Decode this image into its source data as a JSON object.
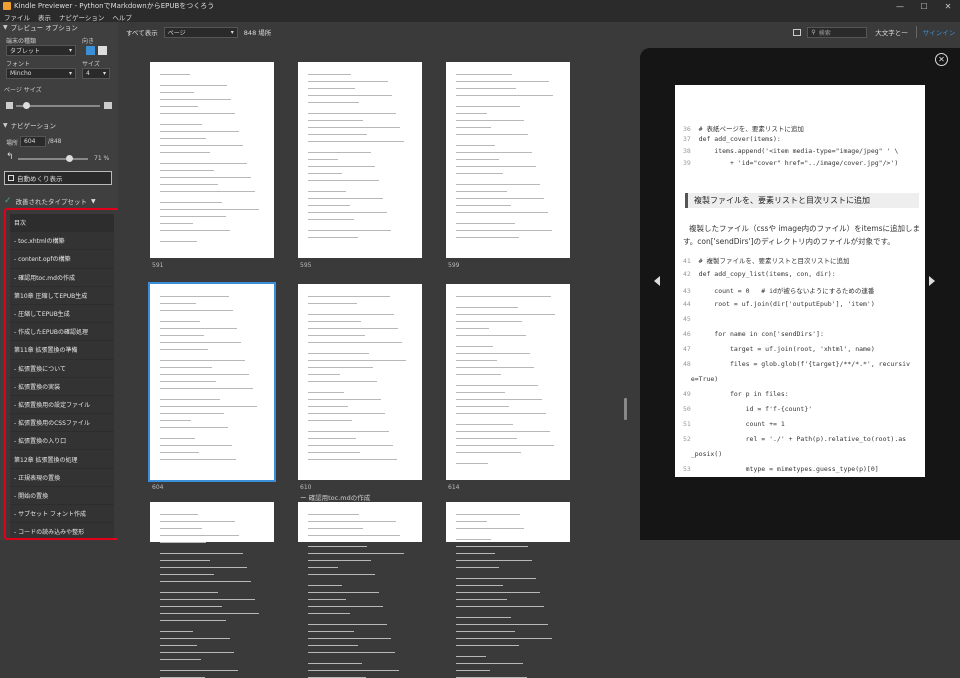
{
  "window": {
    "title": "Kindle Previewer - PythonでMarkdownからEPUBをつくろう",
    "min": "—",
    "max": "☐",
    "close": "✕"
  },
  "menu": [
    "ファイル",
    "表示",
    "ナビゲーション",
    "ヘルプ"
  ],
  "sidebar": {
    "preview_options": "プレビュー オプション",
    "device_type_label": "端末の種類",
    "orientation_label": "向き",
    "device_value": "タブレット",
    "font_label": "フォント",
    "size_label": "サイズ",
    "font_value": "Mincho",
    "size_value": "4",
    "page_size_label": "ページ サイズ",
    "navigation": "ナビゲーション",
    "location_label": "場所",
    "location_value": "604",
    "location_total": "/848",
    "percent": "71 %",
    "auto_advance": "自動めくり表示",
    "tagged_label": "改善されたタイプセット",
    "toc_items": [
      "目次",
      "- toc.xhtmlの構築",
      "- content.opfの構築",
      "- 確認用toc.mdの作成",
      "第10章 圧縮してEPUB生成",
      "- 圧縮してEPUB生成",
      "- 作成したEPUBの確認処理",
      "第11章 拡張置換の準備",
      "- 拡張置換について",
      "- 拡張置換の実装",
      "- 拡張置換用の設定ファイル",
      "- 拡張置換用のCSSファイル",
      "- 拡張置換の入り口",
      "第12章 拡張置換の処理",
      "- 正規表現の置換",
      "- 開始の置換",
      "- サブセット フォント作成",
      "- コードの読み込みや整形"
    ]
  },
  "topbar": {
    "view_label": "すべて表示",
    "view_value": "ページ",
    "count": "848 場所",
    "search_placeholder": "検索",
    "font_big": "大文字と一",
    "signin": "サインイン"
  },
  "pages": [
    {
      "num": "591"
    },
    {
      "num": "595"
    },
    {
      "num": "599"
    },
    {
      "num": "604"
    },
    {
      "num": "610"
    },
    {
      "num": "614"
    }
  ],
  "section_caption": "ー 確認用toc.mdの作成",
  "kindle": {
    "code1": [
      {
        "ln": "36",
        "text": "# 表紙ページを、要素リストに追加"
      },
      {
        "ln": "37",
        "text": "def add_cover(items):"
      },
      {
        "ln": "38",
        "text": "    items.append('<item media-type=\"image/jpeg\" ' \\"
      },
      {
        "ln": "39",
        "text": "        + 'id=\"cover\" href=\"../image/cover.jpg\"/>')"
      }
    ],
    "heading": "複製ファイルを、要素リストと目次リストに追加",
    "para": [
      "複製したファイル（cssや image内のファイル）をitemsに追加しま",
      "す。con['sendDirs']のディレクトリ内のファイルが対象です。"
    ],
    "code2": [
      {
        "ln": "41",
        "text": "# 複製ファイルを、要素リストと目次リストに追加"
      },
      {
        "ln": "42",
        "text": "def add_copy_list(items, con, dir):"
      },
      {
        "ln": "43",
        "text": "    count = 0   # idが被らないようにするための連番"
      },
      {
        "ln": "44",
        "text": "    root = uf.join(dir['outputEpub'], 'item')"
      },
      {
        "ln": "45",
        "text": ""
      },
      {
        "ln": "46",
        "text": "    for name in con['sendDirs']:"
      },
      {
        "ln": "47",
        "text": "        target = uf.join(root, 'xhtml', name)"
      },
      {
        "ln": "48",
        "text": "        files = glob.glob(f'{target}/**/*.*', recursiv"
      },
      {
        "ln": "",
        "text": "e=True)"
      },
      {
        "ln": "49",
        "text": "        for p in files:"
      },
      {
        "ln": "50",
        "text": "            id = f'f-{count}'"
      },
      {
        "ln": "51",
        "text": "            count += 1"
      },
      {
        "ln": "52",
        "text": "            rel = './' + Path(p).relative_to(root).as"
      },
      {
        "ln": "",
        "text": "_posix()"
      },
      {
        "ln": "53",
        "text": "            mtype = mimetypes.guess_type(p)[0]"
      }
    ]
  },
  "colors": {
    "accent": "#3b8fd6",
    "highlight": "#e0001a",
    "check": "#3cb371"
  }
}
